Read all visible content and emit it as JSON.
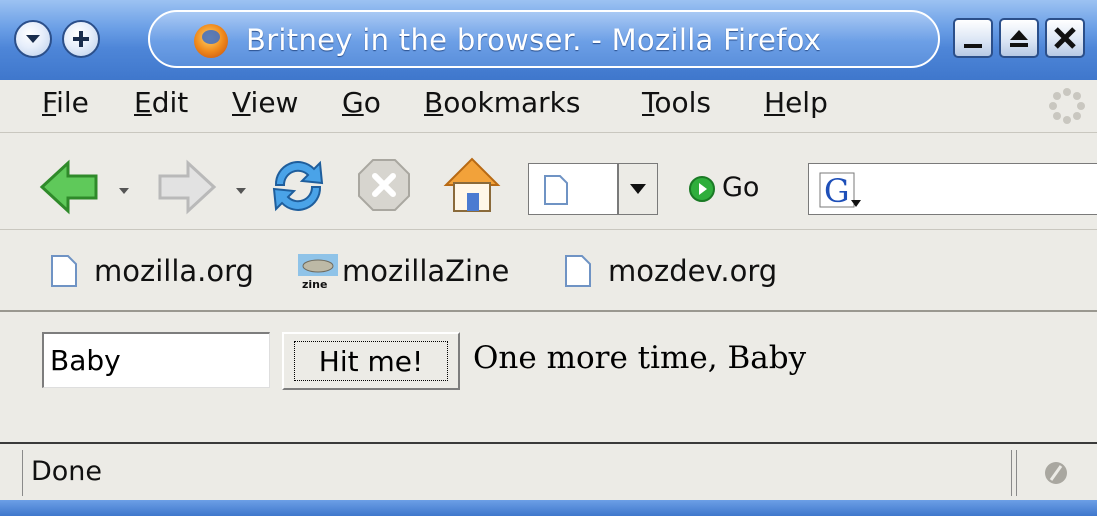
{
  "window": {
    "title": "Britney in the browser. - Mozilla Firefox",
    "accent_color": "#4e86d8",
    "title_icon": "firefox-icon",
    "controls": [
      "minimize-icon",
      "maximize-icon",
      "close-icon"
    ],
    "left_buttons": [
      "window-menu-icon",
      "sticky-icon"
    ]
  },
  "menu": {
    "items": [
      "File",
      "Edit",
      "View",
      "Go",
      "Bookmarks",
      "Tools",
      "Help"
    ]
  },
  "navigation": {
    "go_label": "Go",
    "url_value": "",
    "search_value": ""
  },
  "bookmarks": {
    "items": [
      {
        "label": "mozilla.org",
        "icon": "page-icon"
      },
      {
        "label": "mozillaZine",
        "icon": "zine-icon"
      },
      {
        "label": "mozdev.org",
        "icon": "page-icon"
      }
    ]
  },
  "content": {
    "input_value": "Baby",
    "button_label": "Hit me!",
    "message": "One more time, Baby"
  },
  "status": {
    "text": "Done",
    "security_icon": "security-icon"
  }
}
